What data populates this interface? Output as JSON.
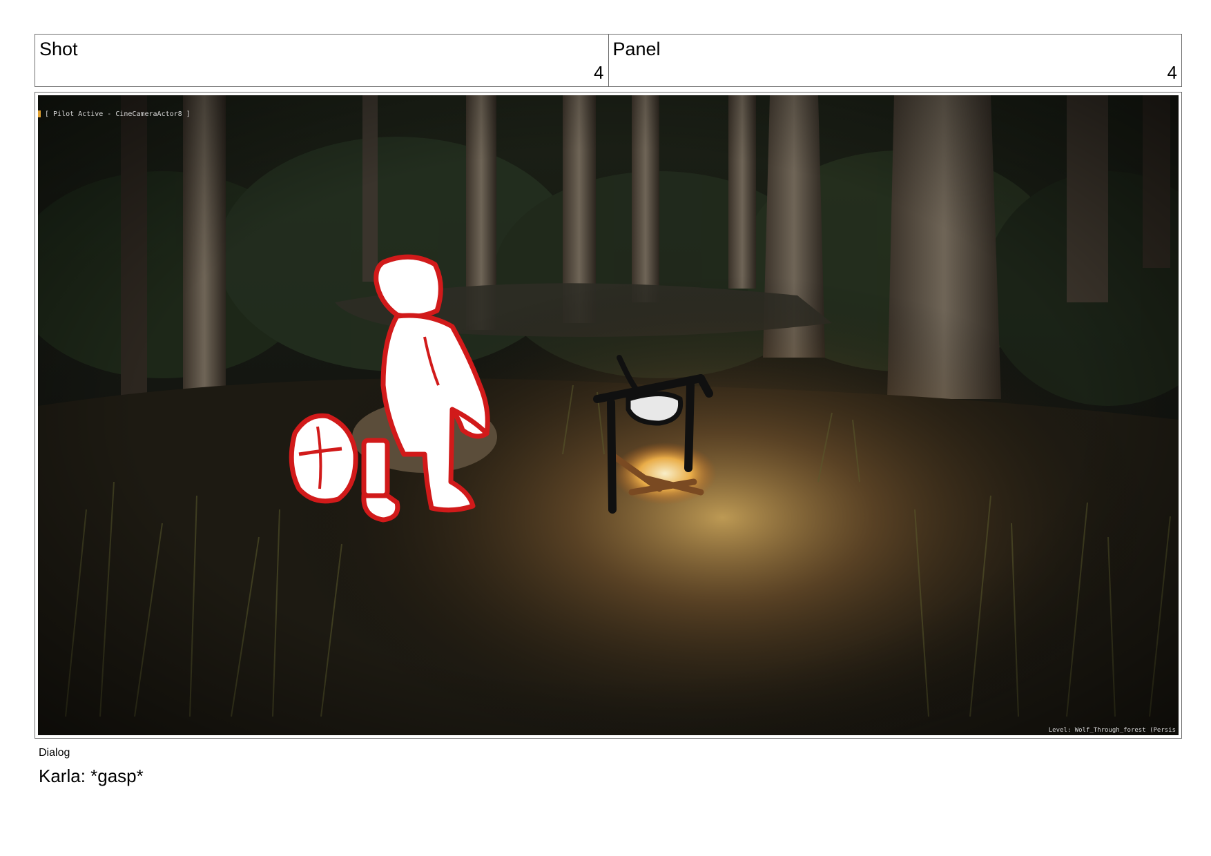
{
  "header": {
    "shot_label": "Shot",
    "shot_number": "4",
    "panel_label": "Panel",
    "panel_number": "4"
  },
  "frame": {
    "overlay_top_left": "[ Pilot Active - CineCameraActor8 ]",
    "overlay_bottom_right": "Level:  Wolf_Through_forest (Persis"
  },
  "dialog": {
    "label": "Dialog",
    "text": "Karla: *gasp*"
  },
  "colors": {
    "sketch_red": "#d11a1a",
    "forest_dark": "#141611",
    "fire_glow": "#f2c46a"
  }
}
